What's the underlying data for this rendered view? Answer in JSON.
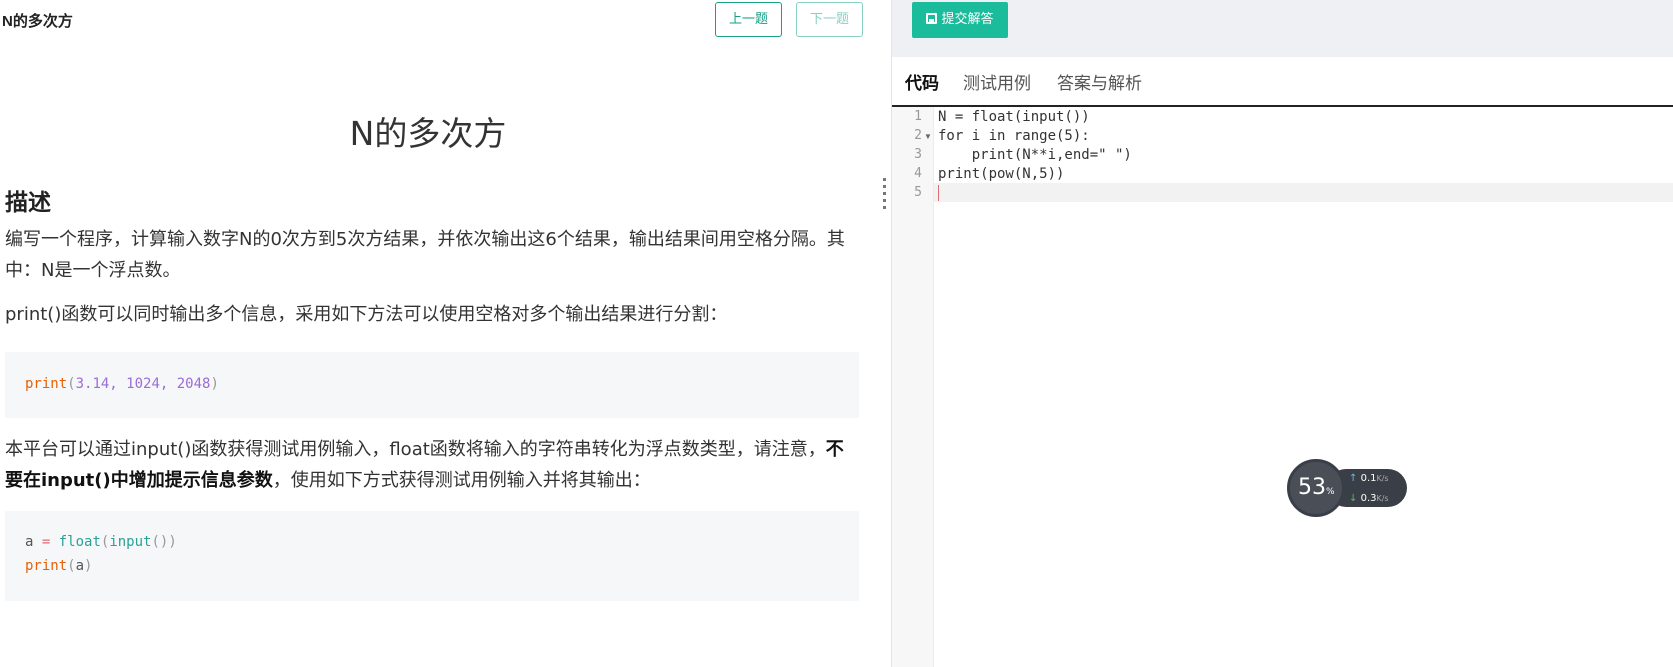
{
  "problem": {
    "header_title": "N的多次方",
    "prev_label": "上一题",
    "next_label": "下一题",
    "big_title": "N的多次方",
    "section_heading": "描述",
    "para1": "编写一个程序，计算输入数字N的0次方到5次方结果，并依次输出这6个结果，输出结果间用空格分隔。其中：N是一个浮点数。",
    "para2": "print()函数可以同时输出多个信息，采用如下方法可以使用空格对多个输出结果进行分割：",
    "code1": {
      "fn": "print",
      "open": "(",
      "args": "3.14, 1024, 2048",
      "close": ")"
    },
    "para3_a": "本平台可以通过input()函数获得测试用例输入，float函数将输入的字符串转化为浮点数类型，请注意，",
    "para3_bold": "不要在input()中增加提示信息参数",
    "para3_b": "，使用如下方式获得测试用例输入并将其输出：",
    "code2": {
      "line1_var": "a",
      "line1_op": " = ",
      "line1_fn": "float",
      "line1_open": "(",
      "line1_fn2": "input",
      "line1_rest": "())",
      "line2_fn": "print",
      "line2_open": "(",
      "line2_arg": "a",
      "line2_close": ")"
    }
  },
  "editor": {
    "submit_label": "提交解答",
    "tabs": [
      {
        "label": "代码",
        "active": true
      },
      {
        "label": "测试用例",
        "active": false
      },
      {
        "label": "答案与解析",
        "active": false
      }
    ],
    "line_numbers": [
      "1",
      "2",
      "3",
      "4",
      "5"
    ],
    "code_lines": [
      "N = float(input())",
      "for i in range(5):",
      "    print(N**i,end=\" \")",
      "print(pow(N,5))",
      ""
    ]
  },
  "net_widget": {
    "percent": "53",
    "percent_unit": "%",
    "up_value": "0.1",
    "down_value": "0.3",
    "unit": "K/s"
  }
}
